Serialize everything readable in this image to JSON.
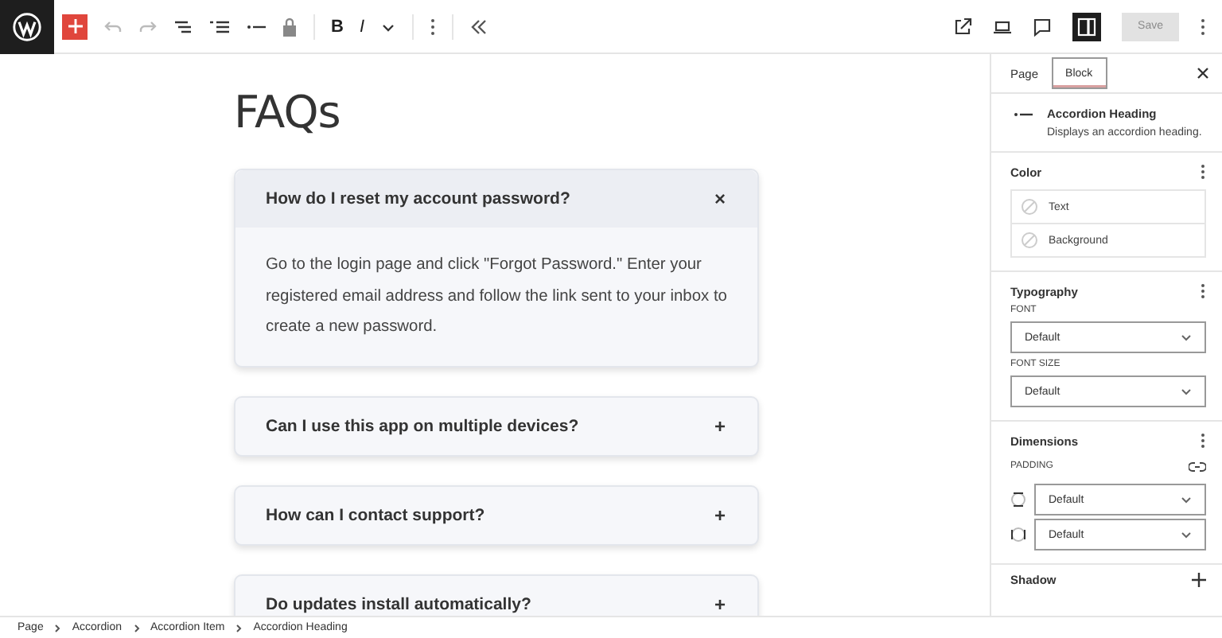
{
  "toolbar": {
    "format_buttons": [
      "B",
      "I"
    ],
    "sidebar_open": true,
    "save": {
      "label": "Save",
      "disabled": true
    }
  },
  "page_title": "FAQs",
  "accordion": [
    {
      "question": "How do I reset my account password?",
      "toggle": "×",
      "expanded": true,
      "answer": "Go to the login page and click \"Forgot Password.\" Enter your registered email address and follow the link sent to your inbox to create a new password."
    },
    {
      "question": "Can I use this app on multiple devices?",
      "toggle": "+",
      "expanded": false
    },
    {
      "question": "How can I contact support?",
      "toggle": "+",
      "expanded": false
    },
    {
      "question": "Do updates install automatically?",
      "toggle": "+",
      "expanded": false
    }
  ],
  "sidebar": {
    "tabs": [
      {
        "label": "Page",
        "selected": false
      },
      {
        "label": "Block",
        "selected": true
      }
    ],
    "block": {
      "title": "Accordion Heading",
      "description": "Displays an accordion heading."
    },
    "color": {
      "title": "Color",
      "items": [
        "Text",
        "Background"
      ]
    },
    "typography": {
      "title": "Typography",
      "fields": [
        {
          "label": "FONT",
          "value": "Default"
        },
        {
          "label": "FONT SIZE",
          "value": "Default"
        }
      ]
    },
    "dimensions": {
      "title": "Dimensions",
      "label": "PADDING",
      "rows": [
        {
          "kind": "vertical",
          "value": "Default"
        },
        {
          "kind": "horizontal",
          "value": "Default"
        }
      ]
    },
    "shadow": {
      "title": "Shadow"
    }
  },
  "breadcrumbs": [
    "Page",
    "Accordion",
    "Accordion Item",
    "Accordion Heading"
  ]
}
